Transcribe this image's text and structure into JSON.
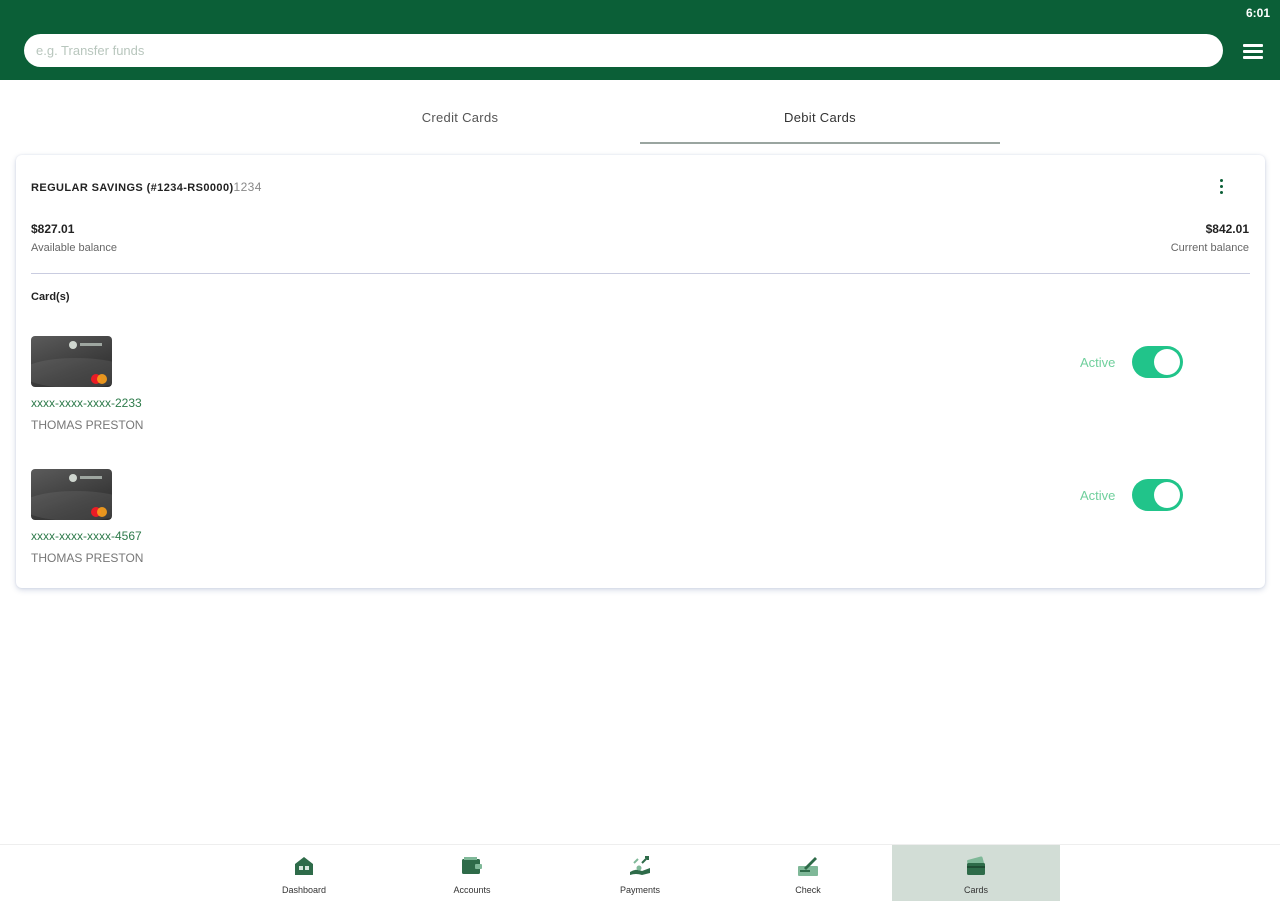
{
  "status_bar": {
    "time": "6:01"
  },
  "search": {
    "placeholder": "e.g. Transfer funds"
  },
  "tabs": [
    {
      "label": "Credit Cards",
      "active": false
    },
    {
      "label": "Debit Cards",
      "active": true
    }
  ],
  "account": {
    "title": "REGULAR SAVINGS (#1234-RS0000)",
    "suffix": "1234",
    "available_balance": "$827.01",
    "available_label": "Available balance",
    "current_balance": "$842.01",
    "current_label": "Current balance",
    "cards_label": "Card(s)"
  },
  "debit_cards": [
    {
      "number": "xxxx-xxxx-xxxx-2233",
      "holder": "THOMAS PRESTON",
      "status": "Active",
      "enabled": true
    },
    {
      "number": "xxxx-xxxx-xxxx-4567",
      "holder": "THOMAS PRESTON",
      "status": "Active",
      "enabled": true
    }
  ],
  "bottom_nav": [
    {
      "label": "Dashboard",
      "icon": "dashboard-icon"
    },
    {
      "label": "Accounts",
      "icon": "accounts-icon"
    },
    {
      "label": "Payments",
      "icon": "payments-icon"
    },
    {
      "label": "Check",
      "icon": "check-icon"
    },
    {
      "label": "Cards",
      "icon": "cards-icon",
      "active": true
    }
  ],
  "colors": {
    "brand": "#0b5f37",
    "toggle_on": "#21c48a",
    "status_text": "#6fcf9c",
    "nav_active_bg": "#d2ddd6"
  }
}
